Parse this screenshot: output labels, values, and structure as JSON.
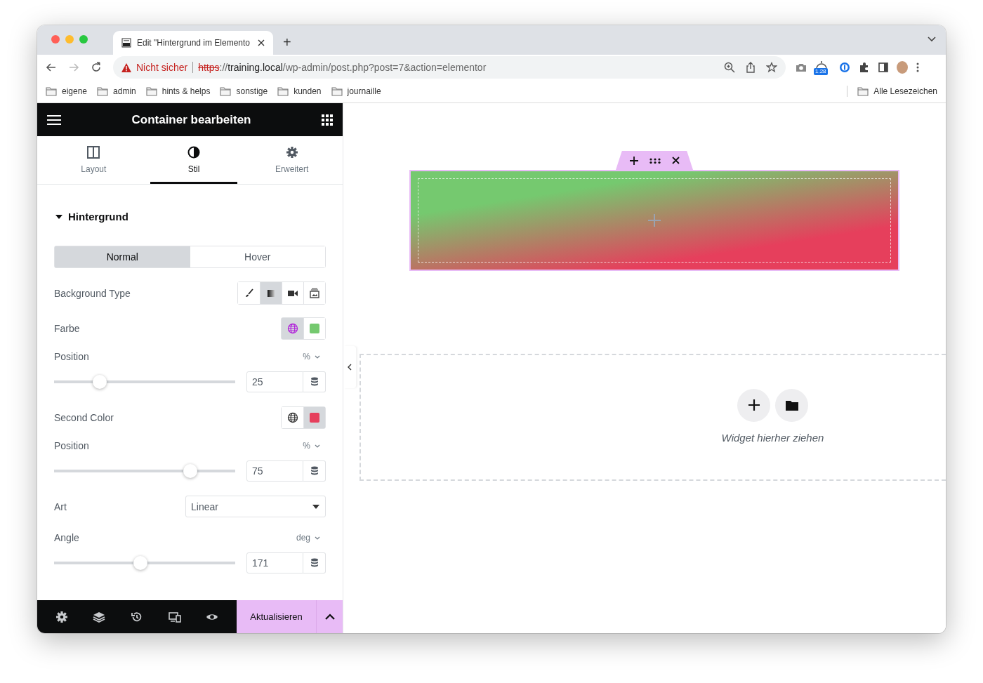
{
  "browser": {
    "tab_title": "Edit \"Hintergrund im Elemento",
    "new_tab": "+",
    "address": {
      "warning": "Nicht sicher",
      "secure": false,
      "scheme": "https",
      "separator": "://",
      "host": "training.local",
      "path": "/wp-admin/post.php?post=7&action=elementor"
    },
    "extension_badge": "1.28",
    "bookmarks": [
      {
        "label": "eigene"
      },
      {
        "label": "admin"
      },
      {
        "label": "hints & helps"
      },
      {
        "label": "sonstige"
      },
      {
        "label": "kunden"
      },
      {
        "label": "journaille"
      }
    ],
    "all_bookmarks": "Alle Lesezeichen"
  },
  "panel": {
    "title": "Container bearbeiten",
    "tabs": [
      {
        "label": "Layout",
        "kind": "layout",
        "selected": false
      },
      {
        "label": "Stil",
        "kind": "style",
        "selected": true
      },
      {
        "label": "Erweitert",
        "kind": "advanced",
        "selected": false
      }
    ],
    "section": {
      "title": "Hintergrund",
      "expanded": true
    },
    "state_tabs": [
      {
        "label": "Normal",
        "selected": true
      },
      {
        "label": "Hover",
        "selected": false
      }
    ],
    "controls": [
      {
        "kind": "bgtype",
        "label": "Background Type",
        "options": [
          {
            "kind": "classic",
            "selected": false
          },
          {
            "kind": "gradient",
            "selected": true
          },
          {
            "kind": "video",
            "selected": false
          },
          {
            "kind": "slideshow",
            "selected": false
          }
        ]
      },
      {
        "kind": "color",
        "label": "Farbe",
        "global": true,
        "color": "#75c96f"
      },
      {
        "kind": "slider",
        "label": "Position",
        "unit": "%",
        "value": "25",
        "level": 0.25
      },
      {
        "kind": "color",
        "label": "Second Color",
        "global": false,
        "color": "#e63f5c"
      },
      {
        "kind": "slider",
        "label": "Position",
        "unit": "%",
        "value": "75",
        "level": 0.75
      },
      {
        "kind": "select",
        "label": "Art",
        "value": "Linear"
      },
      {
        "kind": "slider",
        "label": "Angle",
        "unit": "deg",
        "value": "171",
        "level": 0.475
      }
    ],
    "footer": {
      "button": "Aktualisieren"
    }
  },
  "canvas": {
    "container": {
      "selected": true
    },
    "dropzone": {
      "text": "Widget hierher ziehen"
    }
  }
}
